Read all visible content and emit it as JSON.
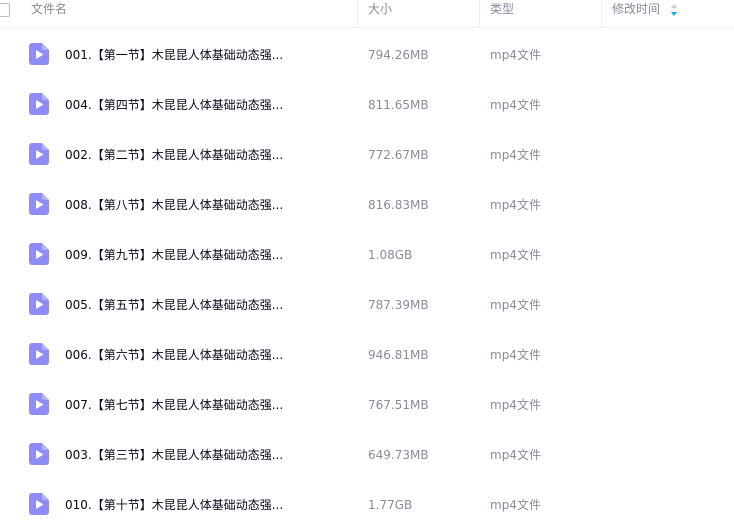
{
  "header": {
    "name_label": "文件名",
    "size_label": "大小",
    "type_label": "类型",
    "date_label": "修改时间"
  },
  "icons": {
    "file_icon": "video-file-icon",
    "sort_icon": "sort-arrows-icon"
  },
  "colors": {
    "accent": "#06a7ff",
    "file_icon": "#8e8cf8"
  },
  "files": [
    {
      "name": "001.【第一节】木昆昆人体基础动态强...",
      "size": "794.26MB",
      "type": "mp4文件"
    },
    {
      "name": "004.【第四节】木昆昆人体基础动态强...",
      "size": "811.65MB",
      "type": "mp4文件"
    },
    {
      "name": "002.【第二节】木昆昆人体基础动态强...",
      "size": "772.67MB",
      "type": "mp4文件"
    },
    {
      "name": "008.【第八节】木昆昆人体基础动态强...",
      "size": "816.83MB",
      "type": "mp4文件"
    },
    {
      "name": "009.【第九节】木昆昆人体基础动态强...",
      "size": "1.08GB",
      "type": "mp4文件"
    },
    {
      "name": "005.【第五节】木昆昆人体基础动态强...",
      "size": "787.39MB",
      "type": "mp4文件"
    },
    {
      "name": "006.【第六节】木昆昆人体基础动态强...",
      "size": "946.81MB",
      "type": "mp4文件"
    },
    {
      "name": "007.【第七节】木昆昆人体基础动态强...",
      "size": "767.51MB",
      "type": "mp4文件"
    },
    {
      "name": "003.【第三节】木昆昆人体基础动态强...",
      "size": "649.73MB",
      "type": "mp4文件"
    },
    {
      "name": "010.【第十节】木昆昆人体基础动态强...",
      "size": "1.77GB",
      "type": "mp4文件"
    }
  ]
}
